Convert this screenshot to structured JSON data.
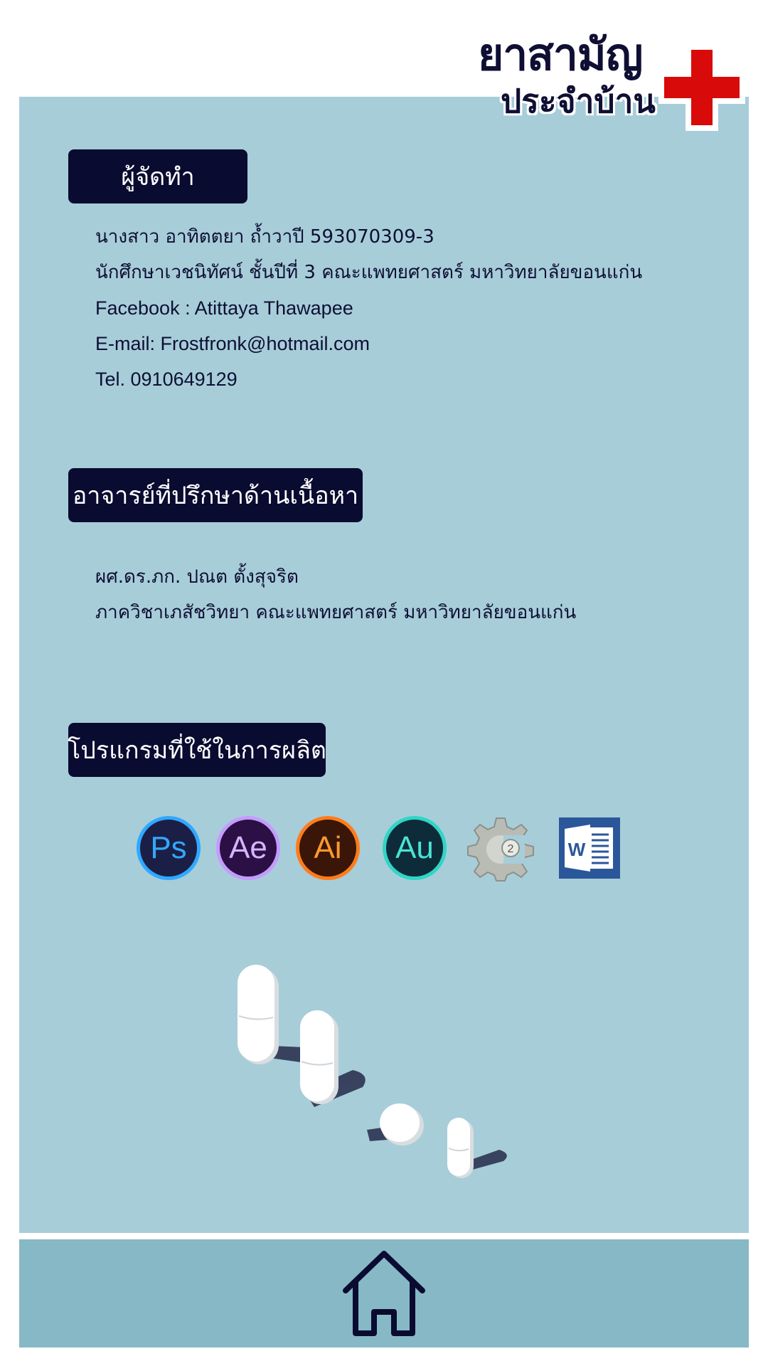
{
  "logo": {
    "line1": "ยาสามัญ",
    "line2": "ประจำบ้าน",
    "cross_color": "#d90a0a"
  },
  "colors": {
    "panel": "#a7cdd9",
    "card": "#c7e1e8",
    "label_bg": "#0a0b30",
    "footer": "#87b8c6"
  },
  "creator": {
    "heading": "ผู้จัดทำ",
    "name": "นางสาว อาทิตตยา ถ้ำวาปี  593070309-3",
    "student": "นักศึกษาเวชนิทัศน์ ชั้นปีที่ 3  คณะแพทยศาสตร์ มหาวิทยาลัยขอนแก่น",
    "facebook": "Facebook : Atittaya Thawapee",
    "email": "E-mail: Frostfronk@hotmail.com",
    "tel": "Tel. 0910649129"
  },
  "advisor": {
    "heading": "อาจารย์ที่ปรึกษาด้านเนื้อหา",
    "name": "ผศ.ดร.ภก. ปณต ตั้งสุจริต",
    "department": "ภาควิชาเภสัชวิทยา  คณะแพทยศาสตร์ มหาวิทยาลัยขอนแก่น"
  },
  "software": {
    "heading": "โปรแกรมที่ใช้ในการผลิต",
    "icons": [
      {
        "icon": "photoshop-icon",
        "label": "Ps"
      },
      {
        "icon": "after-effects-icon",
        "label": "Ae"
      },
      {
        "icon": "illustrator-icon",
        "label": "Ai"
      },
      {
        "icon": "audition-icon",
        "label": "Au"
      },
      {
        "icon": "construct-2-icon",
        "label": "2"
      },
      {
        "icon": "word-icon",
        "label": "W"
      }
    ]
  },
  "footer": {
    "home_icon": "home-icon"
  }
}
